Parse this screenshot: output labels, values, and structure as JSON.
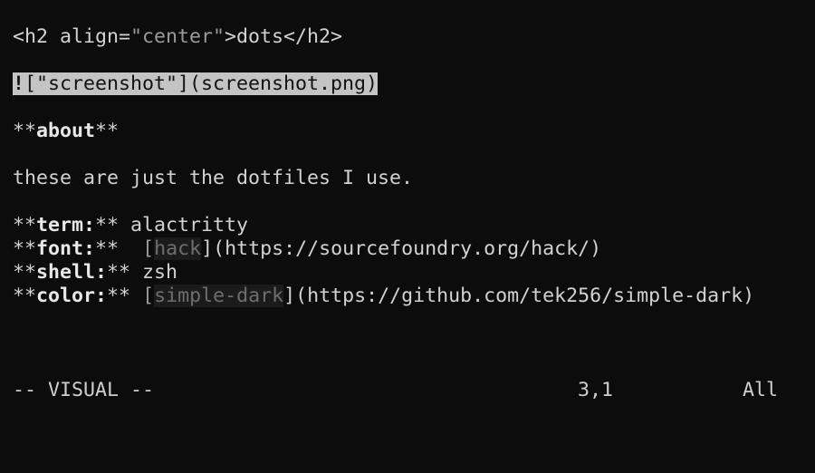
{
  "editor": {
    "lines": {
      "l1": {
        "open_tag": "<h2 align=",
        "attr_value": "\"center\"",
        "tag_rest": ">dots</h2>"
      },
      "l3": {
        "cursor_char": "!",
        "selected": "[\"screenshot\"](screenshot.png)"
      },
      "l5": {
        "stars_open": "**",
        "word": "about",
        "stars_close": "**"
      },
      "l7": {
        "text": "these are just the dotfiles I use."
      },
      "l9": {
        "stars_open": "**",
        "key": "term:",
        "stars_close": "**",
        "value": " alactritty"
      },
      "l10": {
        "stars_open": "**",
        "key": "font:",
        "stars_close": "**",
        "gap": "  ",
        "bracket_open": "[",
        "link_text": "hack",
        "link_rest": "](https://sourcefoundry.org/hack/)"
      },
      "l11": {
        "stars_open": "**",
        "key": "shell:",
        "stars_close": "**",
        "value": " zsh"
      },
      "l12": {
        "stars_open": "**",
        "key": "color:",
        "stars_close": "**",
        "gap": " ",
        "bracket_open": "[",
        "link_text": "simple-dark",
        "link_rest": "](https://github.com/tek256/simple-dark)"
      }
    }
  },
  "statusline": {
    "mode": "-- VISUAL --",
    "cursor_position": "3,1",
    "scroll": "All"
  }
}
